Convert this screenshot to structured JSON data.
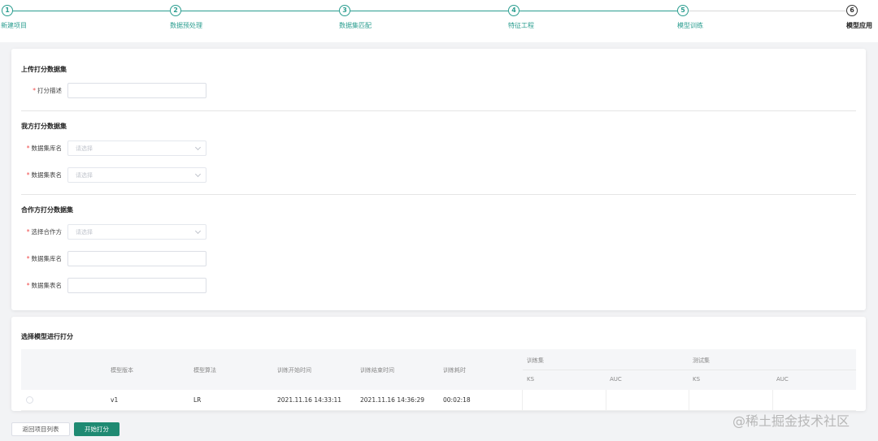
{
  "stepper": {
    "steps": [
      {
        "num": "1",
        "label": "新建项目"
      },
      {
        "num": "2",
        "label": "数据预处理"
      },
      {
        "num": "3",
        "label": "数据集匹配"
      },
      {
        "num": "4",
        "label": "特征工程"
      },
      {
        "num": "5",
        "label": "模型训练"
      },
      {
        "num": "6",
        "label": "模型应用"
      }
    ],
    "active_step": 6
  },
  "upload_section": {
    "title": "上传打分数据集",
    "desc_label": "打分描述",
    "desc_value": ""
  },
  "own_section": {
    "title": "我方打分数据集",
    "db_label": "数据集库名",
    "db_placeholder": "请选择",
    "table_label": "数据集表名",
    "table_placeholder": "请选择"
  },
  "partner_section": {
    "title": "合作方打分数据集",
    "partner_label": "选择合作方",
    "partner_placeholder": "请选择",
    "db_label": "数据集库名",
    "db_value": "",
    "table_label": "数据集表名",
    "table_value": ""
  },
  "model_section": {
    "title": "选择模型进行打分",
    "columns": {
      "version": "模型版本",
      "algorithm": "模型算法",
      "start_time": "训练开始时间",
      "end_time": "训练结束时间",
      "duration": "训练耗时",
      "train_set": "训练集",
      "test_set": "测试集",
      "ks": "KS",
      "auc": "AUC"
    },
    "rows": [
      {
        "version": "v1",
        "algorithm": "LR",
        "start_time": "2021.11.16 14:33:11",
        "end_time": "2021.11.16 14:36:29",
        "duration": "00:02:18",
        "train_ks": "",
        "train_auc": "",
        "test_ks": "",
        "test_auc": ""
      }
    ]
  },
  "actions": {
    "back_label": "返回项目列表",
    "start_label": "开始打分"
  },
  "watermark": "@稀土掘金技术社区",
  "colors": {
    "accent": "#1f8a72",
    "step_line": "#2a9d8f",
    "required": "#f04848"
  }
}
